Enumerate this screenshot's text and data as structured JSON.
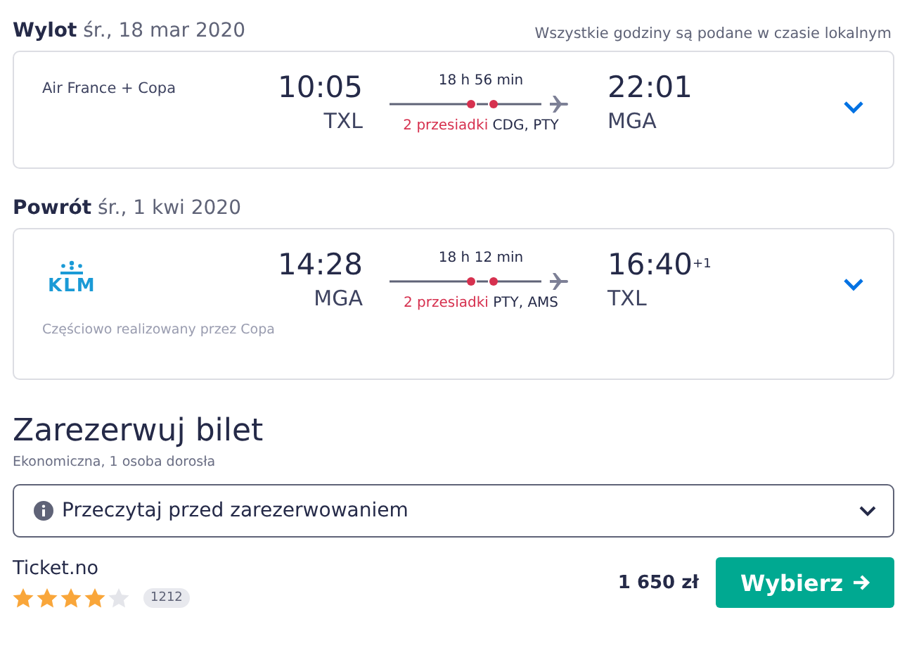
{
  "legs": [
    {
      "label": "Wylot",
      "date": "śr., 18 mar 2020",
      "note": "Wszystkie godziny są podane w czasie lokalnym",
      "airline": "Air France + Copa",
      "dep_time": "10:05",
      "dep_airport": "TXL",
      "duration": "18 h 56 min",
      "stops": "2 przesiadki",
      "via": "CDG, PTY",
      "arr_time": "22:01",
      "arr_airport": "MGA"
    },
    {
      "label": "Powrót",
      "date": "śr., 1 kwi 2020",
      "logo_text": "KLM",
      "dep_time": "14:28",
      "dep_airport": "MGA",
      "duration": "18 h 12 min",
      "stops": "2 przesiadki",
      "via": "PTY, AMS",
      "arr_time": "16:40",
      "day_offset": "+1",
      "arr_airport": "TXL",
      "operated": "Częściowo realizowany przez Copa"
    }
  ],
  "booking": {
    "title": "Zarezerwuj bilet",
    "subtitle": "Ekonomiczna, 1 osoba dorosła",
    "info": "Przeczytaj przed zarezerwowaniem",
    "provider": "Ticket.no",
    "stars": 4,
    "reviews": "1212",
    "price": "1 650 zł",
    "button": "Wybierz"
  }
}
